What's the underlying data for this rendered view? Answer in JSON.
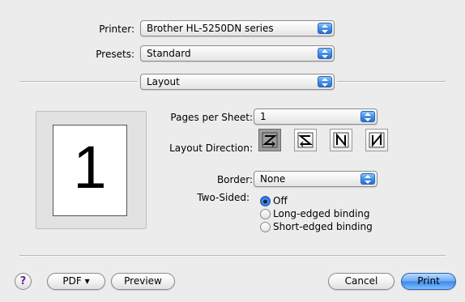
{
  "printer": {
    "label": "Printer:",
    "value": "Brother HL-5250DN series"
  },
  "presets": {
    "label": "Presets:",
    "value": "Standard"
  },
  "panel": {
    "value": "Layout"
  },
  "preview": {
    "page_number": "1"
  },
  "pages_per_sheet": {
    "label": "Pages per Sheet:",
    "value": "1"
  },
  "layout_direction": {
    "label": "Layout Direction:",
    "options": [
      "z-order",
      "reverse-z-order",
      "n-order",
      "reverse-n-order"
    ],
    "selected_index": 0
  },
  "border": {
    "label": "Border:",
    "value": "None"
  },
  "two_sided": {
    "label": "Two-Sided:",
    "options": [
      "Off",
      "Long-edged binding",
      "Short-edged binding"
    ],
    "selected": "Off"
  },
  "footer": {
    "help": "?",
    "pdf": "PDF ▾",
    "preview": "Preview",
    "cancel": "Cancel",
    "print": "Print"
  },
  "colors": {
    "accent": "#3d8ee8",
    "background": "#ececec"
  }
}
